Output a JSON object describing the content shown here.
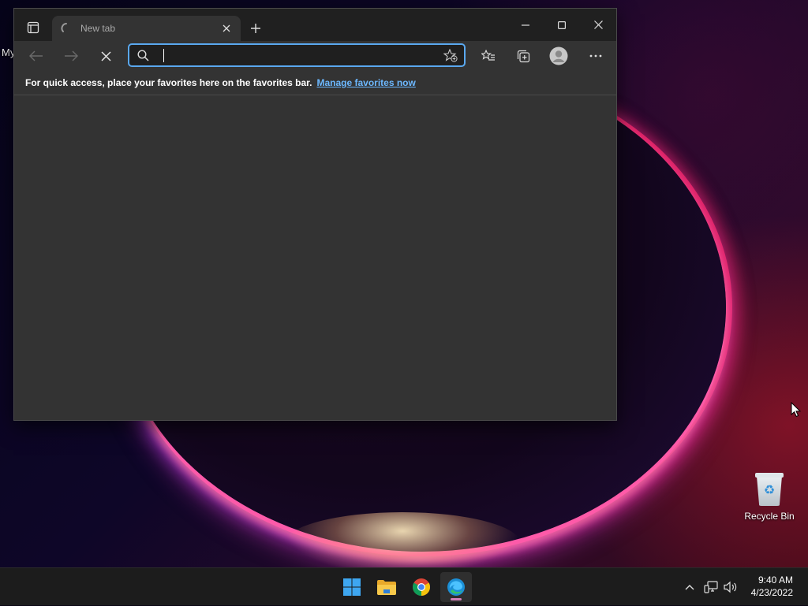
{
  "desktop": {
    "partial_label": "My",
    "recycle_bin_label": "Recycle Bin"
  },
  "browser": {
    "tab": {
      "title": "New tab",
      "spinner_icon": "loading-spinner-icon"
    },
    "toolbar": {
      "address_value": "",
      "address_placeholder": ""
    },
    "favorites_bar": {
      "message": "For quick access, place your favorites here on the favorites bar.",
      "link_text": "Manage favorites now"
    }
  },
  "taskbar": {
    "apps": [
      "start",
      "file-explorer",
      "chrome",
      "edge"
    ],
    "active_app": "edge",
    "clock": {
      "time": "9:40 AM",
      "date": "4/23/2022"
    }
  },
  "colors": {
    "accent": "#5aa8ef",
    "link": "#6cb8ff",
    "browser_bg": "#333333",
    "tabbar_bg": "#202020",
    "taskbar_bg": "#1c1c1c"
  }
}
